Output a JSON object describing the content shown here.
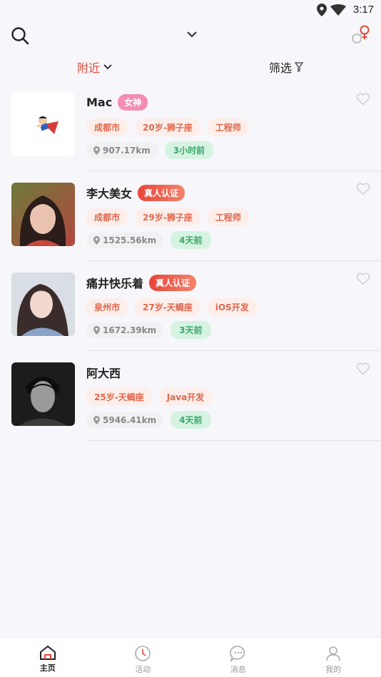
{
  "status_bar": {
    "time": "3:17",
    "icons": [
      "location-icon",
      "wifi-icon"
    ]
  },
  "top_bar": {
    "icons": [
      "search-icon",
      "chevron-down-icon",
      "gender-switch-icon"
    ]
  },
  "filter_bar": {
    "nearby_label": "附近",
    "filter_label": "筛选"
  },
  "colors": {
    "accent": "#e0483a",
    "tag_text": "#e0684e",
    "time_green": "#3aa86a",
    "goddess_pink": "#f58cb4"
  },
  "users": [
    {
      "name": "Mac",
      "badge": "女神",
      "tags": [
        "成都市",
        "20岁-狮子座",
        "工程师"
      ],
      "distance": "907.17km",
      "last_active": "3小时前"
    },
    {
      "name": "李大美女",
      "badge": "真人认证",
      "tags": [
        "成都市",
        "29岁-狮子座",
        "工程师"
      ],
      "distance": "1525.56km",
      "last_active": "4天前"
    },
    {
      "name": "痛井快乐着",
      "badge": "真人认证",
      "tags": [
        "泉州市",
        "27岁-天蝎座",
        "iOS开发"
      ],
      "distance": "1672.39km",
      "last_active": "3天前"
    },
    {
      "name": "阿大西",
      "tags": [
        "25岁-天蝎座",
        "Java开发"
      ],
      "distance": "5946.41km",
      "last_active": "4天前"
    }
  ],
  "bottom_nav": [
    {
      "label": "主页",
      "icon": "home-icon",
      "active": true
    },
    {
      "label": "活动",
      "icon": "clock-icon",
      "active": false
    },
    {
      "label": "消息",
      "icon": "chat-icon",
      "active": false
    },
    {
      "label": "我的",
      "icon": "profile-icon",
      "active": false
    }
  ]
}
